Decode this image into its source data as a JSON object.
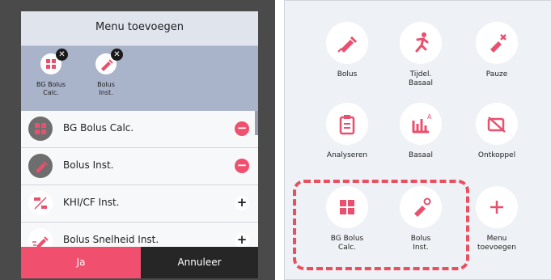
{
  "left_dialog": {
    "title": "Menu toevoegen",
    "shortcuts": [
      {
        "label_line1": "BG Bolus",
        "label_line2": "Calc.",
        "icon": "calculator-icon",
        "remove_symbol": "✕"
      },
      {
        "label_line1": "Bolus",
        "label_line2": "Inst.",
        "icon": "syringe-icon",
        "remove_symbol": "✕"
      }
    ],
    "items": [
      {
        "label": "BG Bolus Calc.",
        "icon": "calculator-icon",
        "action": "−"
      },
      {
        "label": "Bolus Inst.",
        "icon": "syringe-icon",
        "action": "−"
      },
      {
        "label": "KHI/CF Inst.",
        "icon": "cir-cf-icon",
        "action": "+"
      },
      {
        "label": "Bolus Snelheid Inst.",
        "icon": "syringe-speed-icon",
        "action": "+"
      }
    ],
    "buttons": {
      "confirm": "Ja",
      "cancel": "Annuleer"
    }
  },
  "right_menu": {
    "tiles": [
      {
        "line1": "Bolus",
        "line2": "",
        "icon": "syringe-icon"
      },
      {
        "line1": "Tijdel.",
        "line2": "Basaal",
        "icon": "running-person-icon"
      },
      {
        "line1": "Pauze",
        "line2": "",
        "icon": "syringe-pause-icon"
      },
      {
        "line1": "Analyseren",
        "line2": "",
        "icon": "clipboard-icon"
      },
      {
        "line1": "Basaal",
        "line2": "",
        "icon": "bar-chart-icon"
      },
      {
        "line1": "Ontkoppel",
        "line2": "",
        "icon": "disconnect-icon"
      },
      {
        "line1": "BG Bolus",
        "line2": "Calc.",
        "icon": "calculator-icon"
      },
      {
        "line1": "Bolus",
        "line2": "Inst.",
        "icon": "syringe-gear-icon"
      },
      {
        "line1": "Menu",
        "line2": "toevoegen",
        "icon": "plus-icon"
      }
    ]
  },
  "colors": {
    "accent": "#f0506e",
    "dark": "#262626",
    "highlight_dash": "#e8505f"
  }
}
